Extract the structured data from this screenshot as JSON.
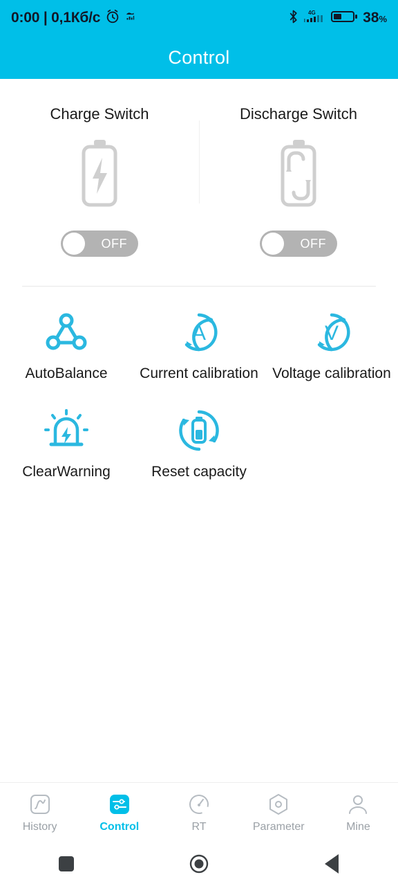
{
  "statusbar": {
    "time_and_speed": "0:00 | 0,1Кб/c",
    "alarm_icon": "alarm-clock-icon",
    "app_icon": "app-notification-icon",
    "bluetooth_icon": "bluetooth-icon",
    "network_type": "4G",
    "signal_icon": "signal-bars-icon",
    "battery_icon": "battery-icon",
    "battery_percent": "38",
    "battery_unit": "%"
  },
  "titlebar": {
    "title": "Control",
    "background_color": "#00BFE8",
    "text_color": "#FFFFFF"
  },
  "switches": [
    {
      "label": "Charge Switch",
      "icon": "battery-charge-icon",
      "state": "OFF",
      "on": false
    },
    {
      "label": "Discharge Switch",
      "icon": "battery-discharge-icon",
      "state": "OFF",
      "on": false
    }
  ],
  "actions": [
    {
      "label": "AutoBalance",
      "icon": "auto-balance-icon"
    },
    {
      "label": "Current calibration",
      "icon": "current-calibration-icon"
    },
    {
      "label": "Voltage calibration",
      "icon": "voltage-calibration-icon"
    },
    {
      "label": "ClearWarning",
      "icon": "clear-warning-icon"
    },
    {
      "label": "Reset capacity",
      "icon": "reset-capacity-icon"
    }
  ],
  "bottom_nav": {
    "active": "Control",
    "items": [
      {
        "label": "History",
        "icon": "history-chart-icon",
        "active": false
      },
      {
        "label": "Control",
        "icon": "sliders-icon",
        "active": true
      },
      {
        "label": "RT",
        "icon": "gauge-icon",
        "active": false
      },
      {
        "label": "Parameter",
        "icon": "hexagon-gear-icon",
        "active": false
      },
      {
        "label": "Mine",
        "icon": "person-icon",
        "active": false
      }
    ]
  },
  "system_nav": {
    "recents_icon": "square-recents-icon",
    "home_icon": "circle-home-icon",
    "back_icon": "triangle-back-icon"
  },
  "colors": {
    "accent": "#00BFE8",
    "toggle_off_track": "#B3B3B3",
    "icon_gray": "#CCCCCC",
    "text_primary": "#1A1A1A",
    "text_muted": "#9AA0A6"
  }
}
